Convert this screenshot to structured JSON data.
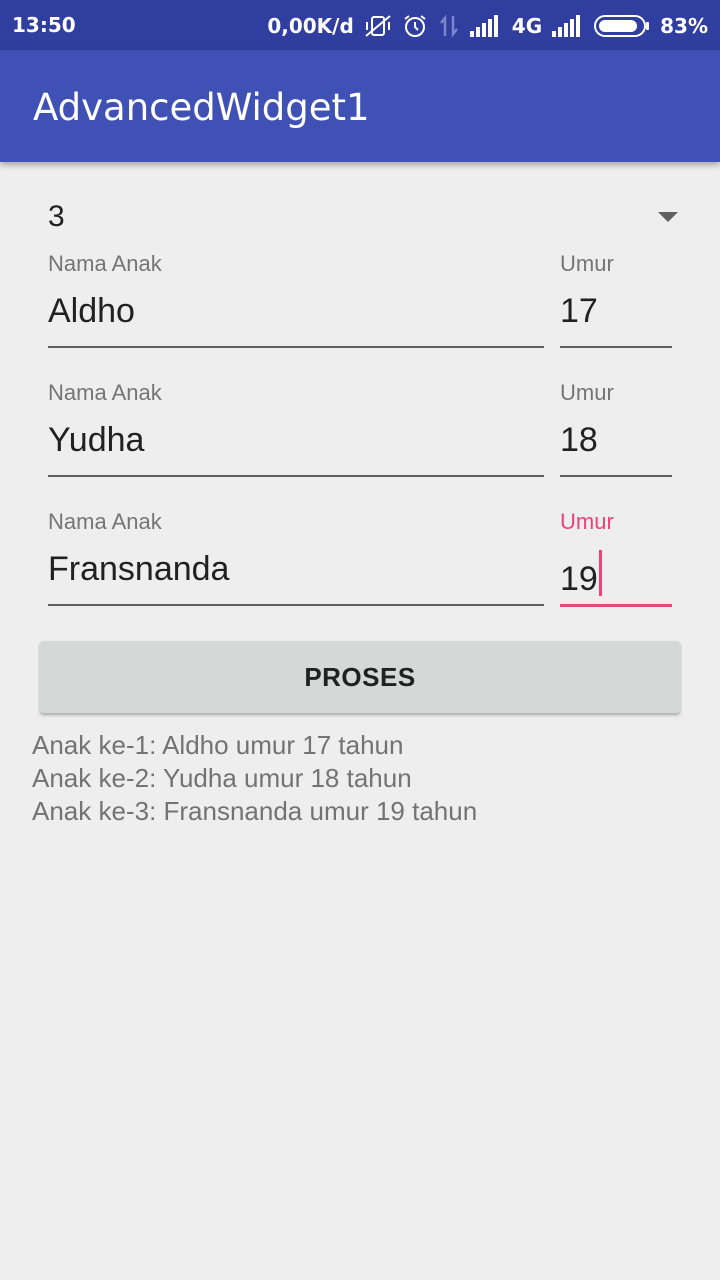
{
  "status_bar": {
    "time": "13:50",
    "net_speed": "0,00K/d",
    "network_type": "4G",
    "battery_percent": "83%",
    "icons": [
      "mute-vibrate-icon",
      "alarm-icon",
      "data-transfer-icon",
      "signal-icon",
      "signal-icon",
      "battery-icon"
    ]
  },
  "app_bar": {
    "title": "AdvancedWidget1"
  },
  "spinner": {
    "selected": "3"
  },
  "rows": [
    {
      "name_label": "Nama Anak",
      "name_value": "Aldho",
      "age_label": "Umur",
      "age_value": "17"
    },
    {
      "name_label": "Nama Anak",
      "name_value": "Yudha",
      "age_label": "Umur",
      "age_value": "18"
    },
    {
      "name_label": "Nama Anak",
      "name_value": "Fransnanda",
      "age_label": "Umur",
      "age_value": "19"
    }
  ],
  "button": {
    "label": "PROSES"
  },
  "results": [
    "Anak ke-1: Aldho umur 17 tahun",
    "Anak ke-2: Yudha umur 18 tahun",
    "Anak ke-3: Fransnanda umur 19 tahun"
  ],
  "colors": {
    "status_bar": "#303f9f",
    "app_bar": "#3f51b5",
    "accent": "#e8447a",
    "background": "#eeeeee",
    "button": "#d6d7d7"
  }
}
